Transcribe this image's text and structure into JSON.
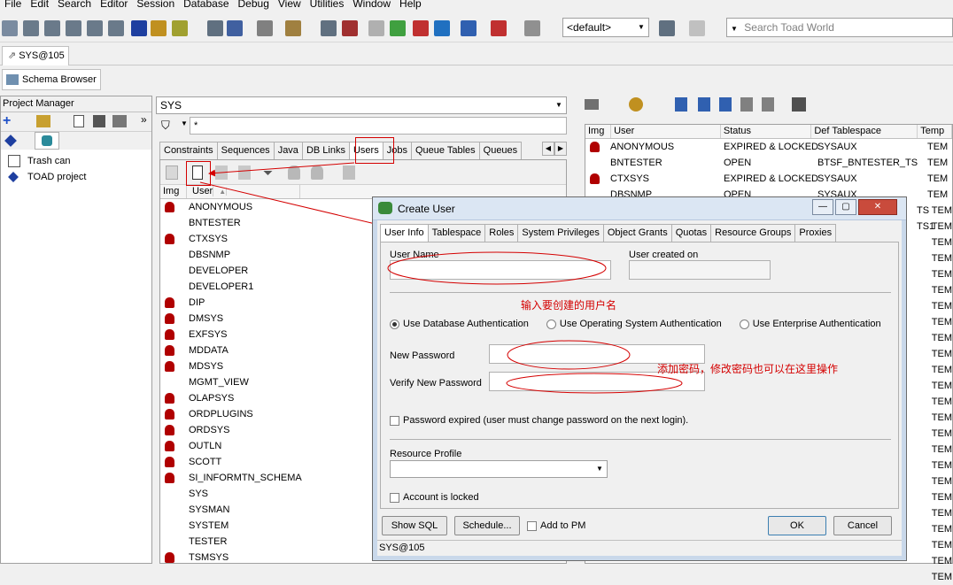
{
  "menu": [
    "File",
    "Edit",
    "Search",
    "Editor",
    "Session",
    "Database",
    "Debug",
    "View",
    "Utilities",
    "Window",
    "Help"
  ],
  "toolbar": {
    "default_combo": "<default>",
    "search_placeholder": "Search Toad World"
  },
  "connection_tab": "SYS@105",
  "schema_browser_tab": "Schema Browser",
  "project_manager": {
    "title": "Project Manager",
    "items": [
      "Trash can",
      "TOAD project"
    ]
  },
  "schema_combo": "SYS",
  "filter_text": "*",
  "object_tabs": [
    "Constraints",
    "Sequences",
    "Java",
    "DB Links",
    "Users",
    "Jobs",
    "Queue Tables",
    "Queues"
  ],
  "users_grid": {
    "headers": [
      "Img",
      "User"
    ],
    "rows": [
      {
        "name": "ANONYMOUS",
        "locked": true
      },
      {
        "name": "BNTESTER",
        "locked": false
      },
      {
        "name": "CTXSYS",
        "locked": true
      },
      {
        "name": "DBSNMP",
        "locked": false
      },
      {
        "name": "DEVELOPER",
        "locked": false
      },
      {
        "name": "DEVELOPER1",
        "locked": false
      },
      {
        "name": "DIP",
        "locked": true
      },
      {
        "name": "DMSYS",
        "locked": true
      },
      {
        "name": "EXFSYS",
        "locked": true
      },
      {
        "name": "MDDATA",
        "locked": true
      },
      {
        "name": "MDSYS",
        "locked": true
      },
      {
        "name": "MGMT_VIEW",
        "locked": false
      },
      {
        "name": "OLAPSYS",
        "locked": true
      },
      {
        "name": "ORDPLUGINS",
        "locked": true
      },
      {
        "name": "ORDSYS",
        "locked": true
      },
      {
        "name": "OUTLN",
        "locked": true
      },
      {
        "name": "SCOTT",
        "locked": true
      },
      {
        "name": "SI_INFORMTN_SCHEMA",
        "locked": true
      },
      {
        "name": "SYS",
        "locked": false
      },
      {
        "name": "SYSMAN",
        "locked": false
      },
      {
        "name": "SYSTEM",
        "locked": false
      },
      {
        "name": "TESTER",
        "locked": false
      },
      {
        "name": "TSMSYS",
        "locked": true
      }
    ]
  },
  "detail_grid": {
    "headers": [
      "Img",
      "User",
      "Status",
      "Def Tablespace",
      "Temp"
    ],
    "rows": [
      {
        "user": "ANONYMOUS",
        "status": "EXPIRED & LOCKED",
        "ts": "SYSAUX",
        "temp": "TEM",
        "locked": true
      },
      {
        "user": "BNTESTER",
        "status": "OPEN",
        "ts": "BTSF_BNTESTER_TS",
        "temp": "TEM",
        "locked": false
      },
      {
        "user": "CTXSYS",
        "status": "EXPIRED & LOCKED",
        "ts": "SYSAUX",
        "temp": "TEM",
        "locked": true
      },
      {
        "user": "DBSNMP",
        "status": "OPEN",
        "ts": "SYSAUX",
        "temp": "TEM",
        "locked": false
      }
    ],
    "extra_temp_rows": [
      "TEM",
      "TEM",
      "TEM",
      "TEM",
      "TEM",
      "TEM",
      "TEM",
      "TEM",
      "TEM",
      "TEM",
      "TEM",
      "TEM",
      "TEM",
      "TEM",
      "TEM",
      "TEM",
      "TEM",
      "TEM",
      "TEM",
      "TEM",
      "TEM",
      "TEM",
      "TEM",
      "TEM"
    ],
    "partial_ts": [
      "TS",
      "TS1"
    ]
  },
  "dialog": {
    "title": "Create User",
    "tabs": [
      "User Info",
      "Tablespace",
      "Roles",
      "System Privileges",
      "Object Grants",
      "Quotas",
      "Resource Groups",
      "Proxies"
    ],
    "user_name_label": "User Name",
    "user_created_label": "User created on",
    "annotation_username": "输入要创建的用户名",
    "auth_options": [
      "Use Database Authentication",
      "Use Operating System Authentication",
      "Use Enterprise Authentication"
    ],
    "new_password_label": "New Password",
    "verify_password_label": "Verify New Password",
    "annotation_password": "添加密码，修改密码也可以在这里操作",
    "password_expired_label": "Password expired (user must change password on the next login).",
    "resource_profile_label": "Resource Profile",
    "account_locked_label": "Account is locked",
    "show_sql": "Show SQL",
    "schedule": "Schedule...",
    "add_to_pm": "Add to PM",
    "ok": "OK",
    "cancel": "Cancel",
    "status": "SYS@105"
  },
  "colors": {
    "annotation": "#d40000",
    "lock": "#b00000"
  }
}
